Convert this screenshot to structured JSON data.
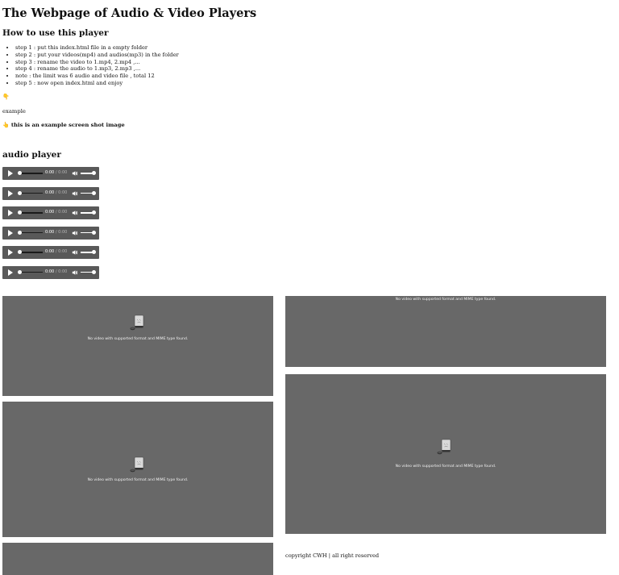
{
  "title": "The Webpage of Audio & Video Players",
  "howto": {
    "heading": "How to use this player",
    "steps": [
      "step 1 : put this index.html file in a empty folder",
      "step 2 : put your videos(mp4) and audios(mp3) in the folder",
      "step 3 : rename the video to 1.mp4, 2.mp4 ,...",
      "step 4 : rename the audio to 1.mp3, 2.mp3 ,...",
      "note : the limit was 6 audio and video file , total 12",
      "step 5 : now open index.html and enjoy"
    ]
  },
  "hand_icon": "pointing-hand-icon",
  "example_label": "example",
  "screenshot_caption": "this is an example screen shot image",
  "audio_section": {
    "heading": "audio player",
    "players": [
      {
        "current": "0:00",
        "separator": " / ",
        "duration": "0:00"
      },
      {
        "current": "0:00",
        "separator": " / ",
        "duration": "0:00"
      },
      {
        "current": "0:00",
        "separator": " / ",
        "duration": "0:00"
      },
      {
        "current": "0:00",
        "separator": " / ",
        "duration": "0:00"
      },
      {
        "current": "0:00",
        "separator": " / ",
        "duration": "0:00"
      },
      {
        "current": "0:00",
        "separator": " / ",
        "duration": "0:00"
      }
    ]
  },
  "video": {
    "error_message": "No video with supported format and MIME type found.",
    "error_icon": "broken-file-icon"
  },
  "colors": {
    "player_bg": "#595959",
    "video_bg": "#686868"
  },
  "footer": "copyright CWH | all right reserved"
}
